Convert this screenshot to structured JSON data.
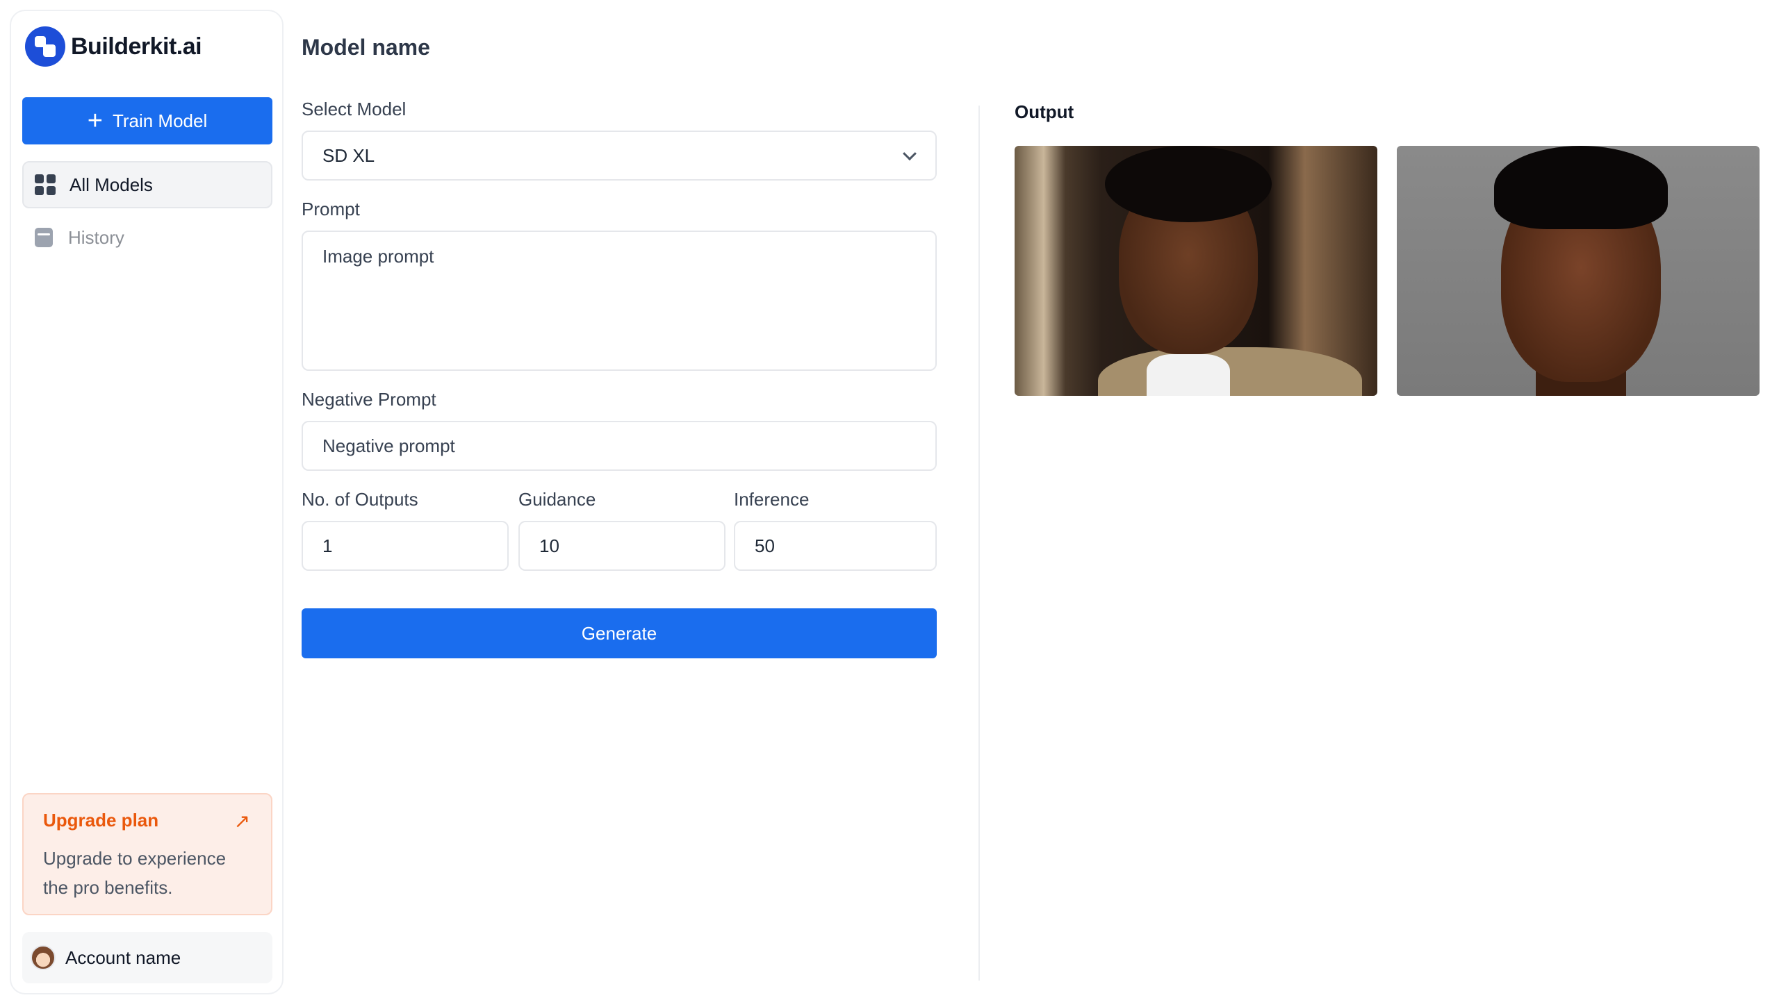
{
  "brand": {
    "name": "Builderkit.ai",
    "color": "#1d4ed8"
  },
  "sidebar": {
    "train_button": "Train Model",
    "nav": [
      {
        "label": "All Models",
        "icon": "grid-icon",
        "active": true
      },
      {
        "label": "History",
        "icon": "history-icon",
        "active": false
      }
    ],
    "upgrade": {
      "title": "Upgrade plan",
      "text_line1": "Upgrade to experience",
      "text_line2": "the pro benefits.",
      "accent": "#ea580c"
    },
    "account": {
      "name": "Account name"
    }
  },
  "main": {
    "title": "Model name",
    "select_model": {
      "label": "Select Model",
      "value": "SD XL"
    },
    "prompt": {
      "label": "Prompt",
      "placeholder": "Image prompt"
    },
    "negative_prompt": {
      "label": "Negative Prompt",
      "placeholder": "Negative prompt"
    },
    "outputs": {
      "label": "No. of Outputs",
      "value": "1"
    },
    "guidance": {
      "label": "Guidance",
      "value": "10"
    },
    "inference": {
      "label": "Inference",
      "value": "50"
    },
    "generate_button": "Generate",
    "accent": "#1a6dee"
  },
  "output": {
    "label": "Output",
    "images": [
      {
        "description_icon": "portrait-image"
      },
      {
        "description_icon": "portrait-image"
      }
    ]
  }
}
